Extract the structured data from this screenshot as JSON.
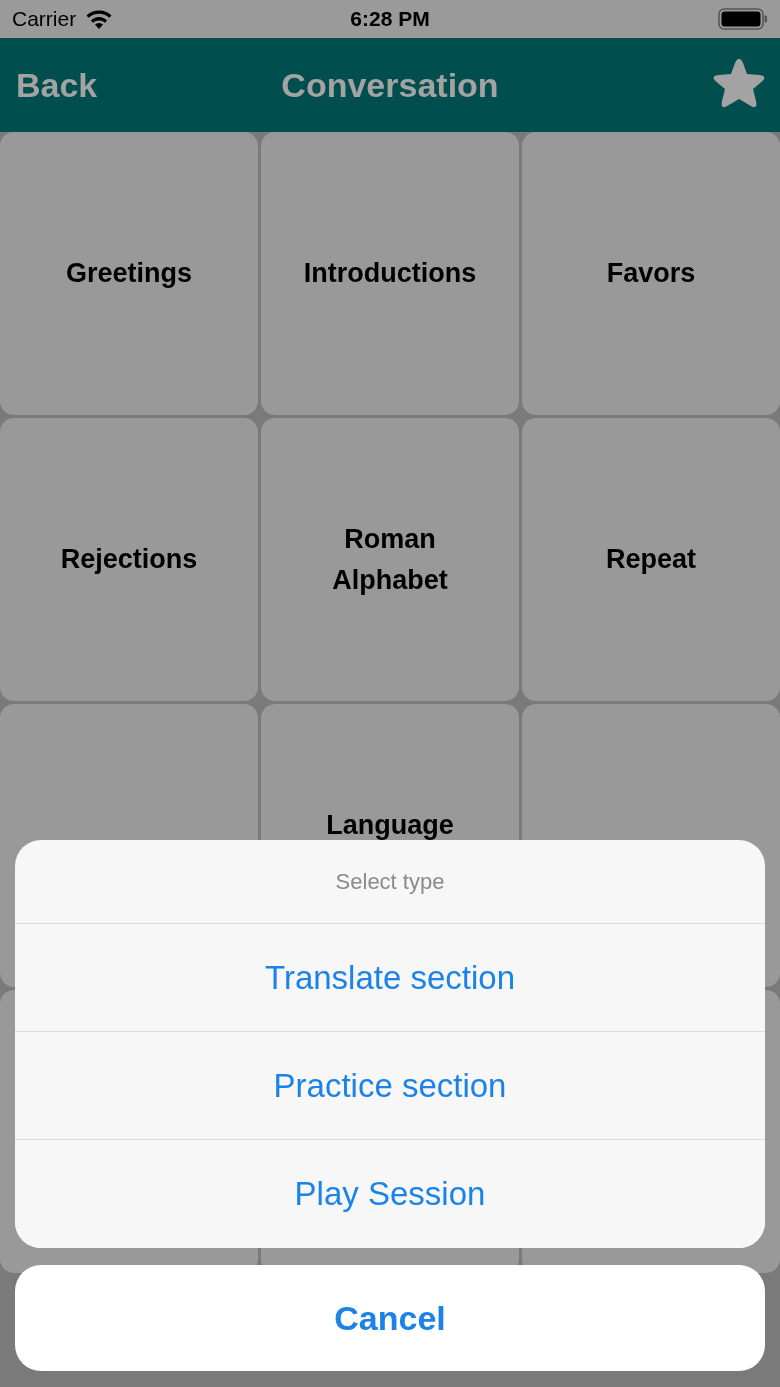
{
  "status_bar": {
    "carrier": "Carrier",
    "time": "6:28 PM"
  },
  "nav_bar": {
    "back": "Back",
    "title": "Conversation"
  },
  "tiles": [
    {
      "label": "Greetings"
    },
    {
      "label": "Introductions"
    },
    {
      "label": "Favors"
    },
    {
      "label": "Rejections"
    },
    {
      "label": "Roman Alphabet"
    },
    {
      "label": "Repeat"
    },
    {
      "label": "Language"
    }
  ],
  "action_sheet": {
    "title": "Select type",
    "actions": [
      "Translate section",
      "Practice section",
      "Play Session"
    ],
    "cancel": "Cancel"
  }
}
